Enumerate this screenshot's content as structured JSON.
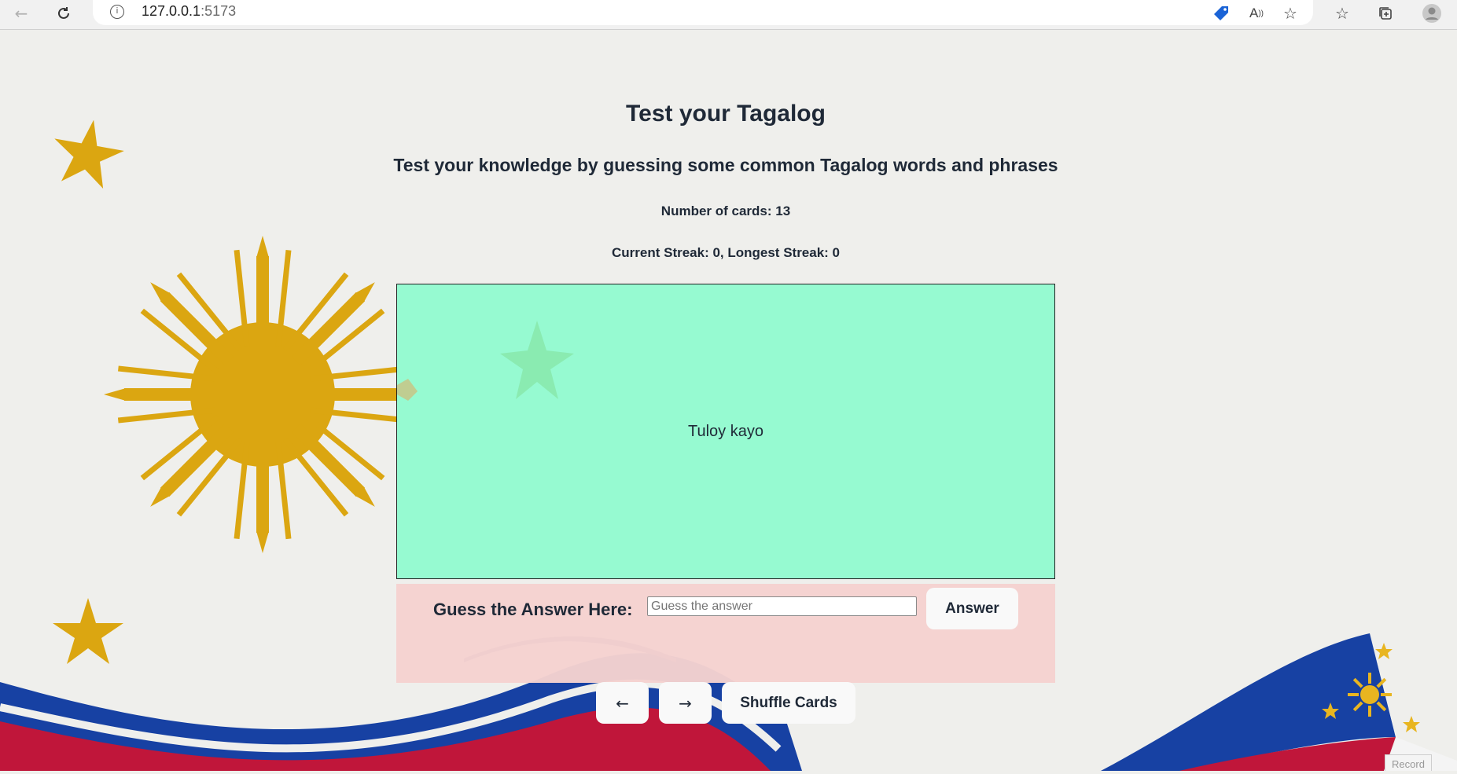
{
  "browser": {
    "url_host": "127.0.0.1",
    "url_port": ":5173"
  },
  "page": {
    "title": "Test your Tagalog",
    "subtitle": "Test your knowledge by guessing some common Tagalog words and phrases",
    "card_count": "Number of cards: 13",
    "streak": "Current Streak: 0, Longest Streak: 0"
  },
  "card": {
    "text": "Tuloy kayo",
    "color": "#96fad1"
  },
  "guess": {
    "label": "Guess the Answer Here:",
    "placeholder": "Guess the answer",
    "value": "",
    "submit_label": "Answer"
  },
  "controls": {
    "prev_label": "←",
    "next_label": "→",
    "shuffle_label": "Shuffle Cards"
  },
  "footer": {
    "record_label": "Record"
  },
  "colors": {
    "background": "#efefec",
    "gold": "#dba611",
    "blue": "#1741a3",
    "red": "#c0163a",
    "guess_panel": "#f5d2d0"
  }
}
